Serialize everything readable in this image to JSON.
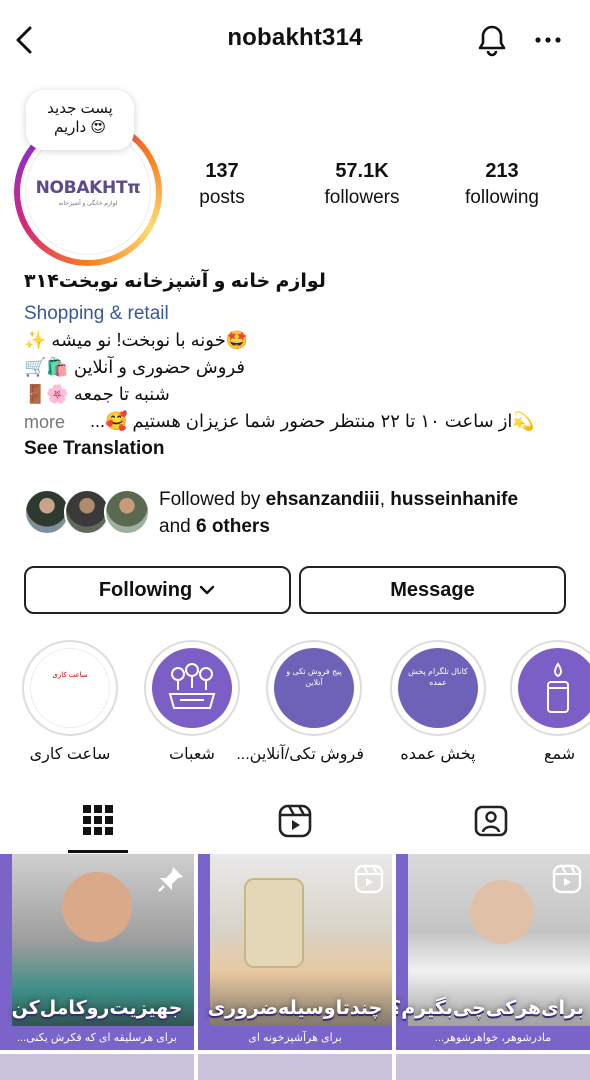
{
  "header": {
    "username": "nobakht314",
    "back_icon": "chevron-left-icon",
    "bell_icon": "bell-icon",
    "more_icon": "more-horizontal-icon"
  },
  "profile": {
    "note_line1": "پست جدید",
    "note_line2": "داریم 😍",
    "logo_text": "NOBAKHTπ",
    "logo_sub": "لوازم خانگی و آشپزخانه",
    "stats": [
      {
        "num": "137",
        "label": "posts"
      },
      {
        "num": "57.1K",
        "label": "followers"
      },
      {
        "num": "213",
        "label": "following"
      }
    ]
  },
  "bio": {
    "name": "لوازم خانه و آشپزخانه نوبخت۳۱۴",
    "category": "Shopping & retail",
    "lines": [
      "🤩خونه با نوبخت! نو میشه ✨",
      "فروش حضوری و آنلاین 🛍️🛒",
      "شنبه تا جمعه 🌸🚪",
      "💫از ساعت ۱۰ تا ۲۲ منتظر حضور شما عزیزان هستیم 🥰..."
    ],
    "more_label": "more",
    "see_translation": "See Translation"
  },
  "followed_by": {
    "prefix": "Followed by ",
    "user1": "ehsanzandiii",
    "sep": ", ",
    "user2": "husseinhanife",
    "and": "and ",
    "others": "6 others"
  },
  "buttons": {
    "following": "Following",
    "message": "Message"
  },
  "highlights": [
    {
      "label": "ساعت کاری",
      "text": "ساعت کاری"
    },
    {
      "label": "شعبات",
      "text": ""
    },
    {
      "label": "فروش تکی/آنلاین...",
      "text": "پیج فروش تکی و آنلاین"
    },
    {
      "label": "پخش عمده",
      "text": "کانال تلگرام پخش عمده"
    },
    {
      "label": "شمع",
      "text": ""
    }
  ],
  "tabs": {
    "grid_icon": "grid-icon",
    "reels_icon": "reels-icon",
    "tagged_icon": "tagged-person-icon"
  },
  "posts": [
    {
      "title": "جهیزیت‌رو‌کامل‌کن",
      "sub": "برای هرسلیقه ای که فکرش یکنی...",
      "icon": "pin-icon"
    },
    {
      "title": "چندتاوسیله‌ضروری",
      "sub": "برای هرآشپزخونه ای",
      "icon": "reels-icon"
    },
    {
      "title": "برای‌هرکی‌چی‌بگیرم؟",
      "sub": "مادرشوهر، خواهرشوهر...",
      "icon": "reels-icon"
    }
  ],
  "colors": {
    "link": "#385898",
    "accent_purple": "#7a63c9",
    "highlight_purple": "#7b5fc6"
  }
}
